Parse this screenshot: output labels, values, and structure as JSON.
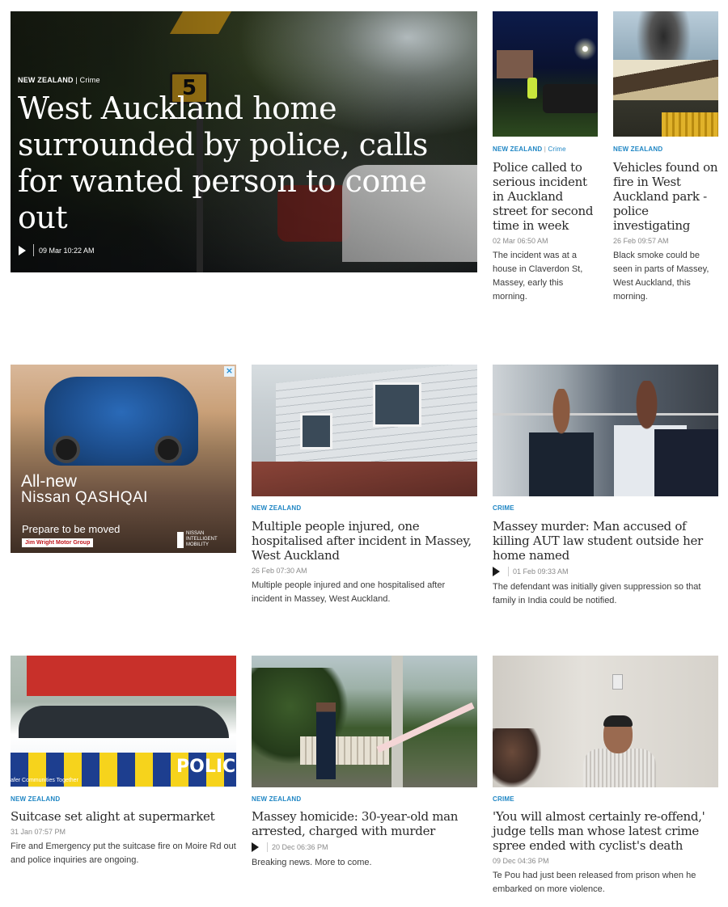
{
  "hero": {
    "category": "NEW ZEALAND",
    "sub_category": "Crime",
    "headline": "West Auckland home surrounded by police, calls for wanted person to come out",
    "date": "09 Mar 10:22 AM",
    "sign_number": "5"
  },
  "side_articles": [
    {
      "category": "NEW ZEALAND",
      "sub_category": "Crime",
      "headline": "Police called to serious incident in Auckland street for second time in week",
      "date": "02 Mar 06:50 AM",
      "summary": "The incident was at a house in Claverdon St, Massey, early this morning."
    },
    {
      "category": "NEW ZEALAND",
      "headline": "Vehicles found on fire in West Auckland park - police investigating",
      "date": "26 Feb 09:57 AM",
      "summary": "Black smoke could be seen in parts of Massey, West Auckland, this morning."
    }
  ],
  "ad": {
    "close_glyph": "×",
    "title_line1": "All-new",
    "title_line2": "Nissan QASHQAI",
    "tagline": "Prepare to be moved",
    "dealer": "Jim Wright Motor Group",
    "brand": "NISSAN INTELLIGENT MOBILITY"
  },
  "middle_articles": [
    {
      "category": "NEW ZEALAND",
      "headline": "Multiple people injured, one hospitalised after incident in Massey, West Auckland",
      "date": "26 Feb 07:30 AM",
      "summary": "Multiple people injured and one hospitalised after incident in Massey, West Auckland."
    },
    {
      "category": "CRIME",
      "headline": "Massey murder: Man accused of killing AUT law student outside her home named",
      "date": "01 Feb 09:33 AM",
      "summary": "The defendant was initially given suppression so that family in India could be notified."
    }
  ],
  "bottom_articles": [
    {
      "category": "NEW ZEALAND",
      "headline": "Suitcase set alight at supermarket",
      "date": "31 Jan 07:57 PM",
      "summary": "Fire and Emergency put the suitcase fire on Moire Rd out and police inquiries are ongoing.",
      "image_text": "POLICE",
      "image_tagline": "afer Communities Together"
    },
    {
      "category": "NEW ZEALAND",
      "headline": "Massey homicide: 30-year-old man arrested, charged with murder",
      "date": "20 Dec 06:36 PM",
      "summary": "Breaking news. More to come."
    },
    {
      "category": "CRIME",
      "headline": "'You will almost certainly re-offend,' judge tells man whose latest crime spree ended with cyclist's death",
      "date": "09 Dec 04:36 PM",
      "summary": "Te Pou had just been released from prison when he embarked on more violence."
    }
  ],
  "colors": {
    "category_blue": "#1f86c4",
    "headline": "#2a2a2a",
    "date_grey": "#8a8a8a"
  },
  "icons": {
    "play": "play-icon",
    "close": "close-icon"
  }
}
